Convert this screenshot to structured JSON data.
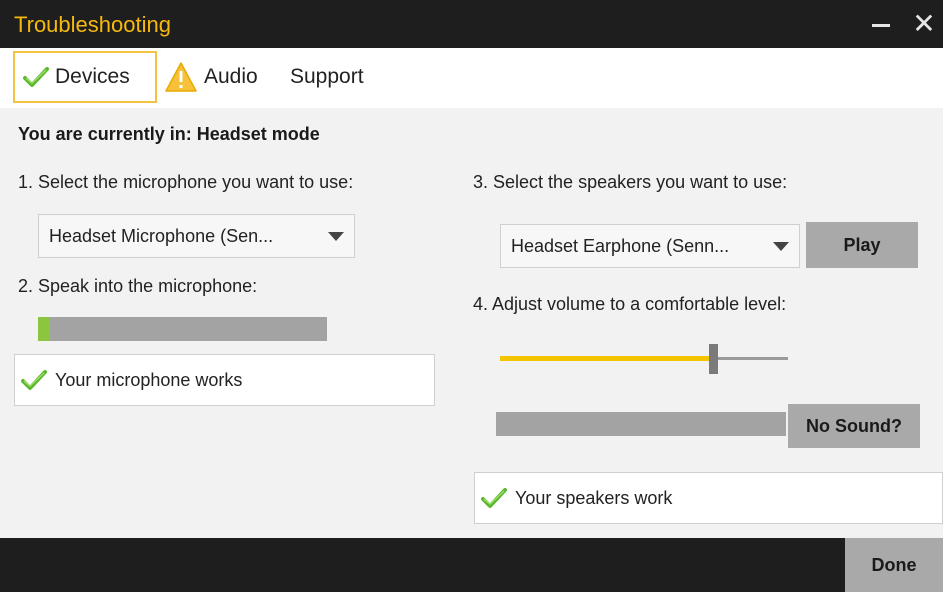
{
  "window": {
    "title": "Troubleshooting"
  },
  "tabs": [
    {
      "label": "Devices",
      "icon": "check-icon",
      "active": true
    },
    {
      "label": "Audio",
      "icon": "warning-icon",
      "active": false
    },
    {
      "label": "Support",
      "icon": "",
      "active": false
    }
  ],
  "mode_text": "You are currently in: Headset mode",
  "microphone": {
    "step_label": "1. Select the microphone you want to use:",
    "selected": "Headset Microphone (Sen...",
    "speak_label": "2. Speak into the microphone:",
    "input_level": 0.04,
    "status": "Your microphone works"
  },
  "speakers": {
    "step_label": "3. Select the speakers you want to use:",
    "selected": "Headset Earphone (Senn...",
    "play_label": "Play",
    "volume_label": "4. Adjust volume to a comfortable level:",
    "volume_level": 0.74,
    "output_level": 0.0,
    "no_sound_label": "No Sound?",
    "status": "Your speakers work"
  },
  "footer": {
    "done_label": "Done"
  },
  "colors": {
    "accent": "#f5b90f",
    "check": "#5cb82e",
    "meter_fill": "#8cc63f",
    "slider_fill": "#f5c400",
    "titlebar": "#1e1e1e"
  }
}
